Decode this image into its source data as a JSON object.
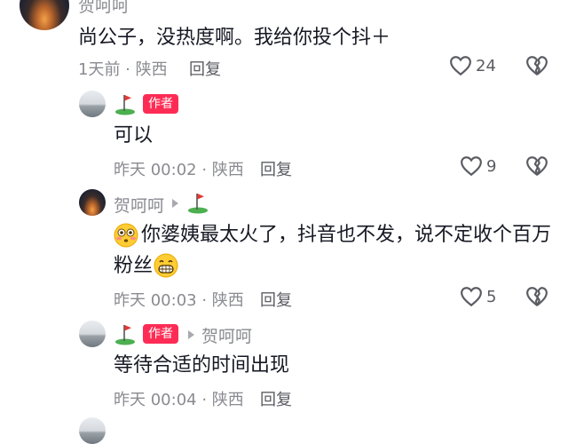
{
  "comments": [
    {
      "username": "贺呵呵",
      "text": "尚公子，没热度啊。我给你投个抖＋",
      "meta": "1天前 · 陕西",
      "reply_label": "回复",
      "likes": "24"
    },
    {
      "author_badge": "作者",
      "text": "可以",
      "meta": "昨天 00:02 · 陕西",
      "reply_label": "回复",
      "likes": "9"
    },
    {
      "username": "贺呵呵",
      "text_line1": "你婆姨最太火了，抖音也不发，说不定收个百万",
      "text_line2": "粉丝",
      "meta": "昨天 00:03 · 陕西",
      "reply_label": "回复",
      "likes": "5"
    },
    {
      "author_badge": "作者",
      "reply_to": "贺呵呵",
      "text": "等待合适的时间出现",
      "meta": "昨天 00:04 · 陕西",
      "reply_label": "回复"
    }
  ],
  "icons": {
    "heart": "heart-outline-icon",
    "dislike": "broken-heart-icon",
    "golf": "golf-flag-emoji",
    "flushed": "flushed-face-emoji",
    "grin": "grinning-face-emoji"
  }
}
